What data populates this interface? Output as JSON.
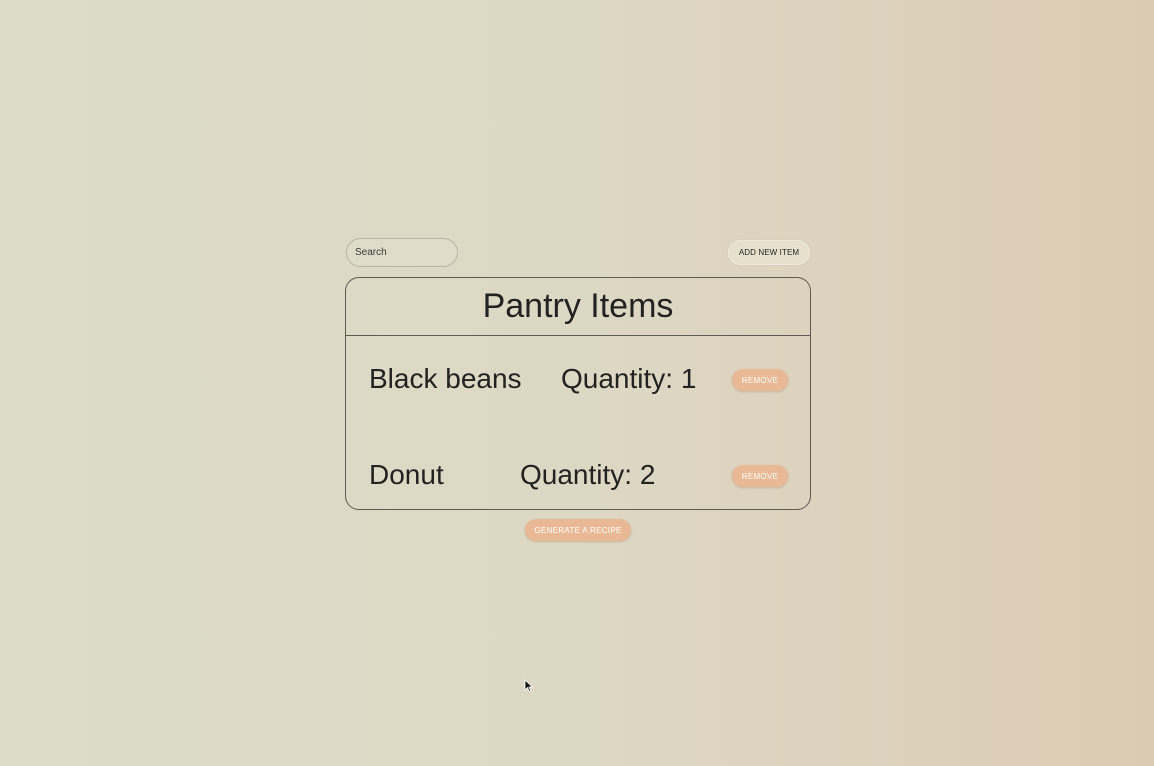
{
  "search": {
    "placeholder": "Search",
    "value": ""
  },
  "toolbar": {
    "add_label": "ADD NEW ITEM"
  },
  "panel": {
    "title": "Pantry Items"
  },
  "items": [
    {
      "name": "Black beans",
      "quantity_label": "Quantity: 1",
      "quantity": 1,
      "remove_label": "REMOVE"
    },
    {
      "name": "Donut",
      "quantity_label": "Quantity: 2",
      "quantity": 2,
      "remove_label": "REMOVE"
    }
  ],
  "actions": {
    "generate_label": "GENERATE A RECIPE"
  },
  "colors": {
    "accent": "#e8b994",
    "border": "#5d5b55"
  },
  "icons": {
    "cursor": "mouse-pointer-icon"
  }
}
